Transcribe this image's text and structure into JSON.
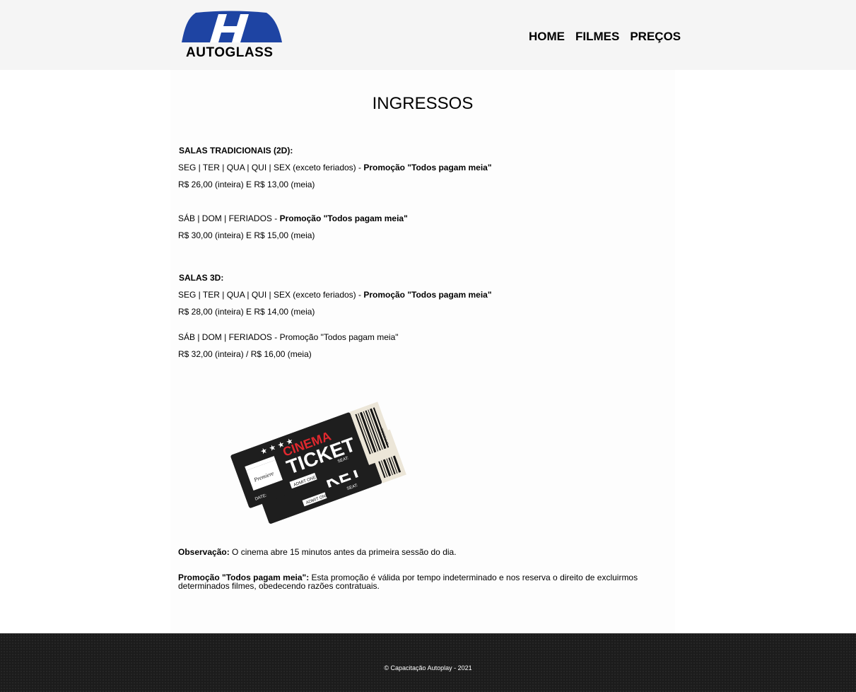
{
  "header": {
    "logo_text": "AUTOGLASS",
    "nav": [
      {
        "label": "HOME"
      },
      {
        "label": "FILMES"
      },
      {
        "label": "PREÇOS"
      }
    ]
  },
  "page": {
    "title": "INGRESSOS"
  },
  "sections": [
    {
      "title": "SALAS TRADICIONAIS (2D):",
      "rows": [
        {
          "days": "SEG | TER | QUA | QUI | SEX (exceto feriados) - ",
          "promo": "Promoção \"Todos pagam meia\"",
          "price": "R$ 26,00 (inteira) E R$ 13,00 (meia)"
        },
        {
          "days": "SÁB | DOM | FERIADOS - ",
          "promo": "Promoção \"Todos pagam meia\"",
          "price": "R$ 30,00 (inteira) E R$ 15,00 (meia)"
        }
      ]
    },
    {
      "title": "SALAS 3D:",
      "rows": [
        {
          "days": "SEG | TER | QUA | QUI | SEX (exceto feriados) - ",
          "promo": "Promoção \"Todos pagam meia\"",
          "price": "R$ 28,00 (inteira) E R$ 14,00 (meia)"
        },
        {
          "days": "SÁB | DOM | FERIADOS - Promoção \"Todos pagam meia\"",
          "promo": "",
          "price": "R$ 32,00 (inteira) / R$ 16,00 (meia)"
        }
      ]
    }
  ],
  "ticket_image": {
    "title_top": "CINEMA",
    "title_bottom": "TICKET",
    "clapper_text": "Premiere",
    "seat_label": "SEAT:",
    "date_label": "DATE:",
    "admit_label": "ADMIT ONE",
    "barcode_label": "BARCODE",
    "back_ticket_text": "KET",
    "accent_color": "#e0282e",
    "ticket_color": "#1e1e1e",
    "stub_color": "#ece6d8"
  },
  "notes": {
    "obs_label": "Observação:",
    "obs_text": " O cinema abre 15 minutos antes da primeira sessão do dia.",
    "promo_label": "Promoção \"Todos pagam meia\":",
    "promo_text": " Esta promoção é válida por tempo indeterminado e nos reserva o direito de excluirmos determinados filmes, obedecendo razões contratuais."
  },
  "footer": {
    "text": "© Capacitação Autoplay - 2021"
  },
  "colors": {
    "logo_blue": "#1e44a3",
    "header_bg": "#f5f5f5",
    "footer_bg": "#1c1c1c"
  }
}
